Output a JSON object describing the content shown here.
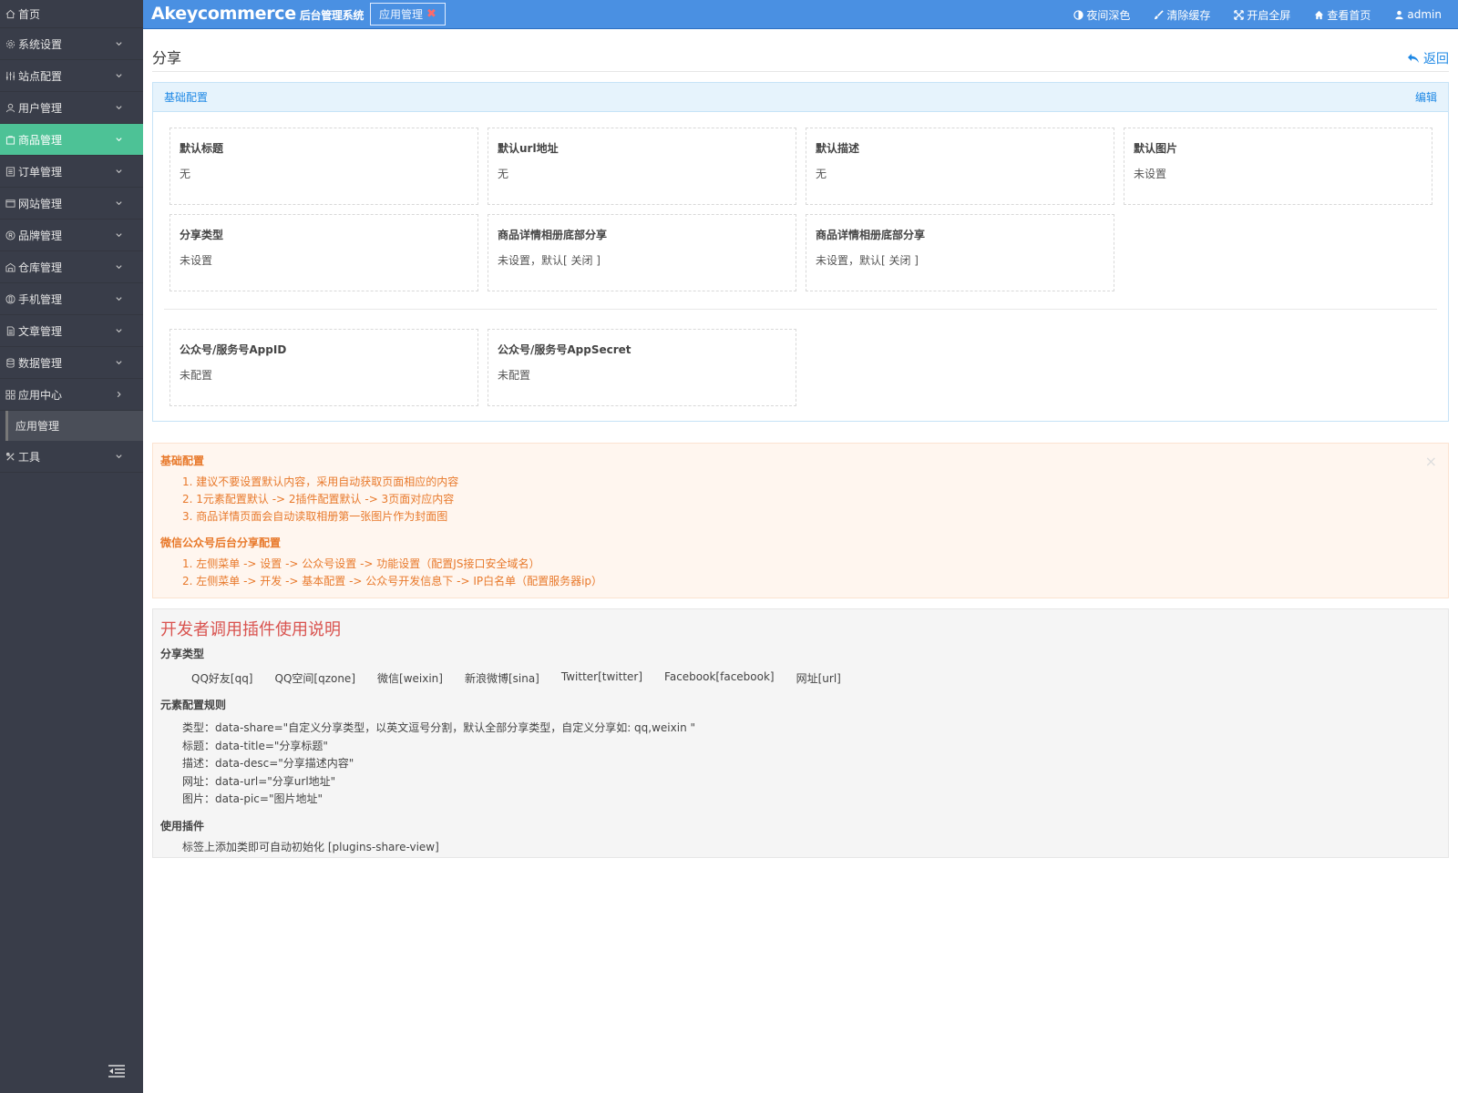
{
  "sidebar": {
    "home": "首页",
    "items": [
      {
        "label": "系统设置",
        "icon": "gear-icon"
      },
      {
        "label": "站点配置",
        "icon": "sliders-icon"
      },
      {
        "label": "用户管理",
        "icon": "user-icon"
      },
      {
        "label": "商品管理",
        "icon": "bag-icon",
        "active": true
      },
      {
        "label": "订单管理",
        "icon": "list-icon"
      },
      {
        "label": "网站管理",
        "icon": "browser-icon"
      },
      {
        "label": "品牌管理",
        "icon": "registered-icon"
      },
      {
        "label": "仓库管理",
        "icon": "warehouse-icon"
      },
      {
        "label": "手机管理",
        "icon": "mobile-icon"
      },
      {
        "label": "文章管理",
        "icon": "document-icon"
      },
      {
        "label": "数据管理",
        "icon": "database-icon"
      },
      {
        "label": "应用中心",
        "icon": "apps-icon",
        "expanded": true
      }
    ],
    "sub_item": "应用管理",
    "tools": "工具"
  },
  "topbar": {
    "brand": "Akeycommerce",
    "brand_sub": "后台管理系统",
    "tab": "应用管理",
    "nav": [
      "夜间深色",
      "清除缓存",
      "开启全屏",
      "查看首页",
      "admin"
    ]
  },
  "page": {
    "title": "分享",
    "back": "返回"
  },
  "panel": {
    "title": "基础配置",
    "edit": "编辑",
    "cards": [
      {
        "label": "默认标题",
        "value": "无"
      },
      {
        "label": "默认url地址",
        "value": "无"
      },
      {
        "label": "默认描述",
        "value": "无"
      },
      {
        "label": "默认图片",
        "value": "未设置"
      },
      {
        "label": "分享类型",
        "value": "未设置"
      },
      {
        "label": "商品详情相册底部分享",
        "value": "未设置，默认[ 关闭 ]"
      },
      {
        "label": "商品详情相册底部分享",
        "value": "未设置，默认[ 关闭 ]"
      },
      {
        "label": "公众号/服务号AppID",
        "value": "未配置"
      },
      {
        "label": "公众号/服务号AppSecret",
        "value": "未配置"
      }
    ]
  },
  "notice": {
    "title1": "基础配置",
    "items1": [
      "1. 建议不要设置默认内容，采用自动获取页面相应的内容",
      "2. 1元素配置默认 -> 2插件配置默认 -> 3页面对应内容",
      "3. 商品详情页面会自动读取相册第一张图片作为封面图"
    ],
    "title2": "微信公众号后台分享配置",
    "items2": [
      "1. 左侧菜单 -> 设置 -> 公众号设置 -> 功能设置（配置JS接口安全域名）",
      "2. 左侧菜单 -> 开发 -> 基本配置 -> 公众号开发信息下 -> IP白名单（配置服务器ip）"
    ],
    "close": "×"
  },
  "dev": {
    "title": "开发者调用插件使用说明",
    "share_type_title": "分享类型",
    "share_types": [
      "QQ好友[qq]",
      "QQ空间[qzone]",
      "微信[weixin]",
      "新浪微博[sina]",
      "Twitter[twitter]",
      "Facebook[facebook]",
      "网址[url]"
    ],
    "rule_title": "元素配置规则",
    "rules": [
      "类型：data-share=\"自定义分享类型，以英文逗号分割，默认全部分享类型，自定义分享如: qq,weixin \"",
      "标题：data-title=\"分享标题\"",
      "描述：data-desc=\"分享描述内容\"",
      "网址：data-url=\"分享url地址\"",
      "图片：data-pic=\"图片地址\""
    ],
    "use_title": "使用插件",
    "use_text": "标签上添加类即可自动初始化 [plugins-share-view]"
  }
}
